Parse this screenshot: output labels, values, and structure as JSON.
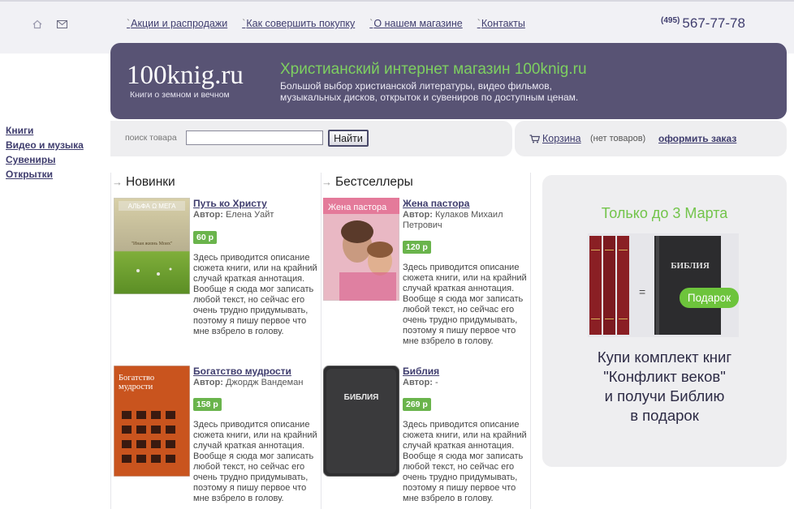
{
  "header": {
    "nav": [
      "Акции и распродажи",
      "Как совершить покупку",
      "О нашем магазине",
      "Контакты"
    ],
    "phone_code": "(495)",
    "phone_number": "567-77-78"
  },
  "banner": {
    "logo": "100knig.ru",
    "logo_sub": "Книги о земном и вечном",
    "title": "Христианский интернет магазин 100knig.ru",
    "desc": "Большой выбор христианской литературы, видео фильмов, музыкальных дисков, открыток и сувениров по доступным ценам."
  },
  "search": {
    "label": "поиск товара",
    "value": "",
    "button": "Найти"
  },
  "cart": {
    "link": "Корзина",
    "status": "(нет товаров)",
    "checkout": "оформить заказ"
  },
  "leftnav": [
    "Книги",
    "Видео и музыка",
    "Сувениры",
    "Открытки"
  ],
  "sections": {
    "new": "Новинки",
    "best": "Бестселлеры"
  },
  "products": [
    {
      "title": "Путь ко Христу",
      "author_label": "Автор:",
      "author": "Елена Уайт",
      "price": "60 р",
      "desc": "Здесь приводится описание сюжета книги, или на крайний случай краткая аннотация. Вообще я сюда мог записать любой текст, но сейчас его очень трудно придумывать, поэтому я пишу первое что мне взбрело в голову.",
      "cover_text": "АЛЬФА Ω МЕГА",
      "cover_sub": "\"Иная жизнь Моих\""
    },
    {
      "title": "Жена пастора",
      "author_label": "Автор:",
      "author": "Кулаков Михаил Петрович",
      "price": "120 р",
      "desc": "Здесь приводится описание сюжета книги, или на крайний случай краткая аннотация. Вообще я сюда мог записать любой текст, но сейчас его очень трудно придумывать, поэтому я пишу первое что мне взбрело в голову.",
      "cover_text": "Жена пастора"
    },
    {
      "title": "Богатство мудрости",
      "author_label": "Автор:",
      "author": "Джордж Вандеман",
      "price": "158 р",
      "desc": "Здесь приводится описание сюжета книги, или на крайний случай краткая аннотация. Вообще я сюда мог записать любой текст, но сейчас его очень трудно придумывать, поэтому я пишу первое что мне взбрело в голову.",
      "cover_text": "Богатство мудрости"
    },
    {
      "title": "Библия",
      "author_label": "Автор:",
      "author": "-",
      "price": "269 р",
      "desc": "Здесь приводится описание сюжета книги, или на крайний случай краткая аннотация. Вообще я сюда мог записать любой текст, но сейчас его очень трудно придумывать, поэтому я пишу первое что мне взбрело в голову.",
      "cover_text": "БИБЛИЯ"
    }
  ],
  "promo": {
    "title": "Только до 3 Марта",
    "equals": "=",
    "bible_label": "БИБЛИЯ",
    "gift": "Подарок",
    "text_lines": [
      "Купи комплект книг",
      "\"Конфликт веков\"",
      "и получи Библию",
      "в подарок"
    ]
  }
}
